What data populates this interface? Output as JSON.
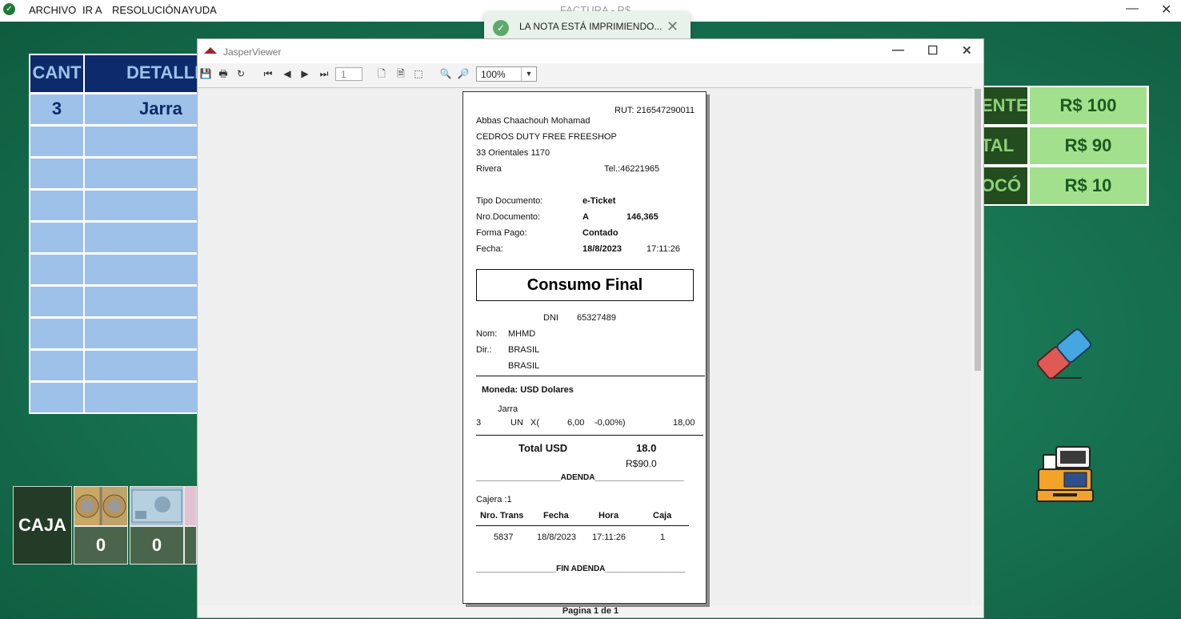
{
  "menubar": {
    "items": [
      "ARCHIVO",
      "IR A",
      "RESOLUCIÓN",
      "AYUDA"
    ],
    "title": "FACTURA - R$",
    "minimize": "—",
    "close": "✕"
  },
  "toast": {
    "message": "LA NOTA ESTÁ IMPRIMIENDO...",
    "close": "✕"
  },
  "left_table": {
    "headers": [
      "CANT",
      "DETALLE"
    ],
    "rows": [
      {
        "cant": "3",
        "detalle": "Jarra"
      }
    ]
  },
  "caja": {
    "label": "CAJA",
    "counts": [
      "0",
      "0",
      ""
    ]
  },
  "totals": {
    "rows": [
      {
        "label": "ENTE",
        "value": "R$ 100"
      },
      {
        "label": "TAL",
        "value": "R$ 90"
      },
      {
        "label": "OCÓ",
        "value": "R$ 10"
      }
    ]
  },
  "jasper": {
    "title": "JasperViewer",
    "page_input": "1",
    "zoom": "100%",
    "status": "Pagina 1 de 1"
  },
  "receipt": {
    "rut": "RUT: 216547290011",
    "owner": "Abbas Chaachouh Mohamad",
    "company": "CEDROS DUTY FREE FREESHOP",
    "address": "33 Orientales 1170",
    "city": "Rivera",
    "tel": "Tel.:46221965",
    "tipo_label": "Tipo Documento:",
    "tipo_value": "e-Ticket",
    "nro_label": "Nro.Documento:",
    "nro_serie": "A",
    "nro_value": "146,365",
    "forma_label": "Forma Pago:",
    "forma_value": "Contado",
    "fecha_label": "Fecha:",
    "fecha_value": "18/8/2023",
    "hora_value": "17:11:26",
    "consumo": "Consumo Final",
    "dni_label": "DNI",
    "dni_value": "65327489",
    "nom_label": "Nom:",
    "nom_value": "MHMD",
    "dir_label": "Dir.:",
    "dir_value1": "BRASIL",
    "dir_value2": "BRASIL",
    "moneda": "Moneda: USD   Dolares",
    "item_name": "Jarra",
    "item_qty": "3",
    "item_un": "UN",
    "item_x": "X(",
    "item_price": "6,00",
    "item_disc": "-0,00%)",
    "item_total": "18,00",
    "total_label": "Total USD",
    "total_usd": "18.0",
    "total_brl": "R$90.0",
    "adenda": "___________________ADENDA____________________",
    "cajera": "Cajera :1",
    "cols": [
      "Nro. Trans",
      "Fecha",
      "Hora",
      "Caja"
    ],
    "trans": [
      "5837",
      "18/8/2023",
      "17:11:26",
      "1"
    ],
    "fin": "__________________FIN ADENDA__________________"
  }
}
